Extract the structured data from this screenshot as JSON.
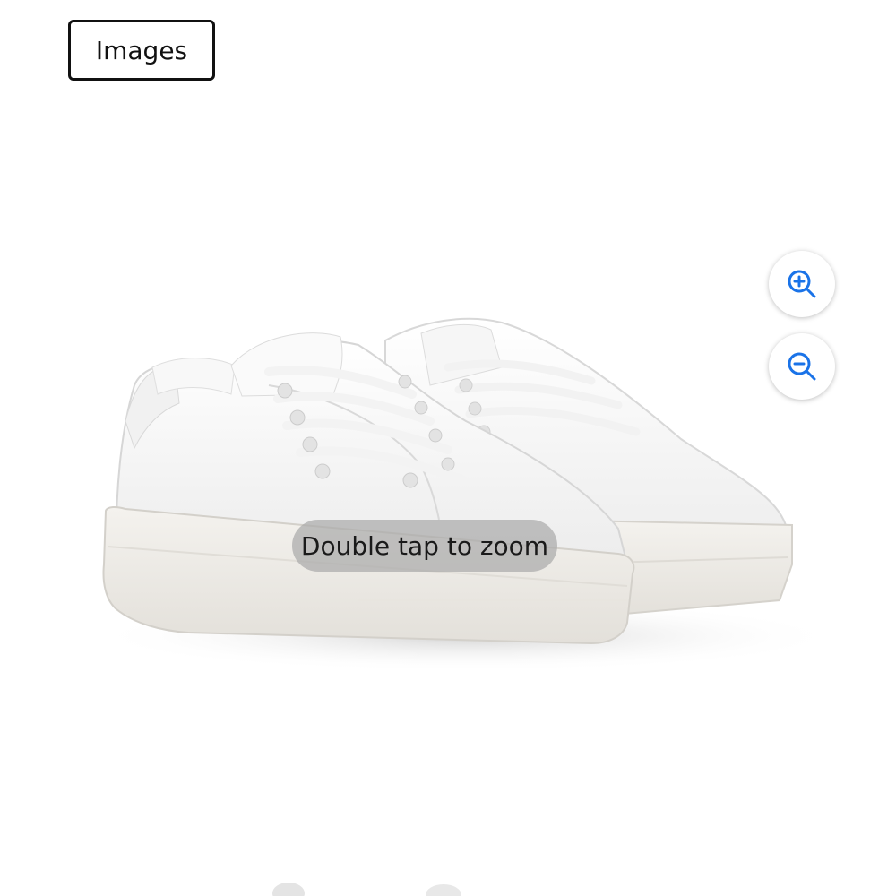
{
  "header": {
    "images_label": "Images"
  },
  "viewer": {
    "image_alt": "White leather lace-up sneakers",
    "zoom_in_icon": "zoom-in-icon",
    "zoom_out_icon": "zoom-out-icon",
    "hint": "Double tap to zoom"
  },
  "colors": {
    "accent": "#1a73e8",
    "border": "#111111"
  }
}
